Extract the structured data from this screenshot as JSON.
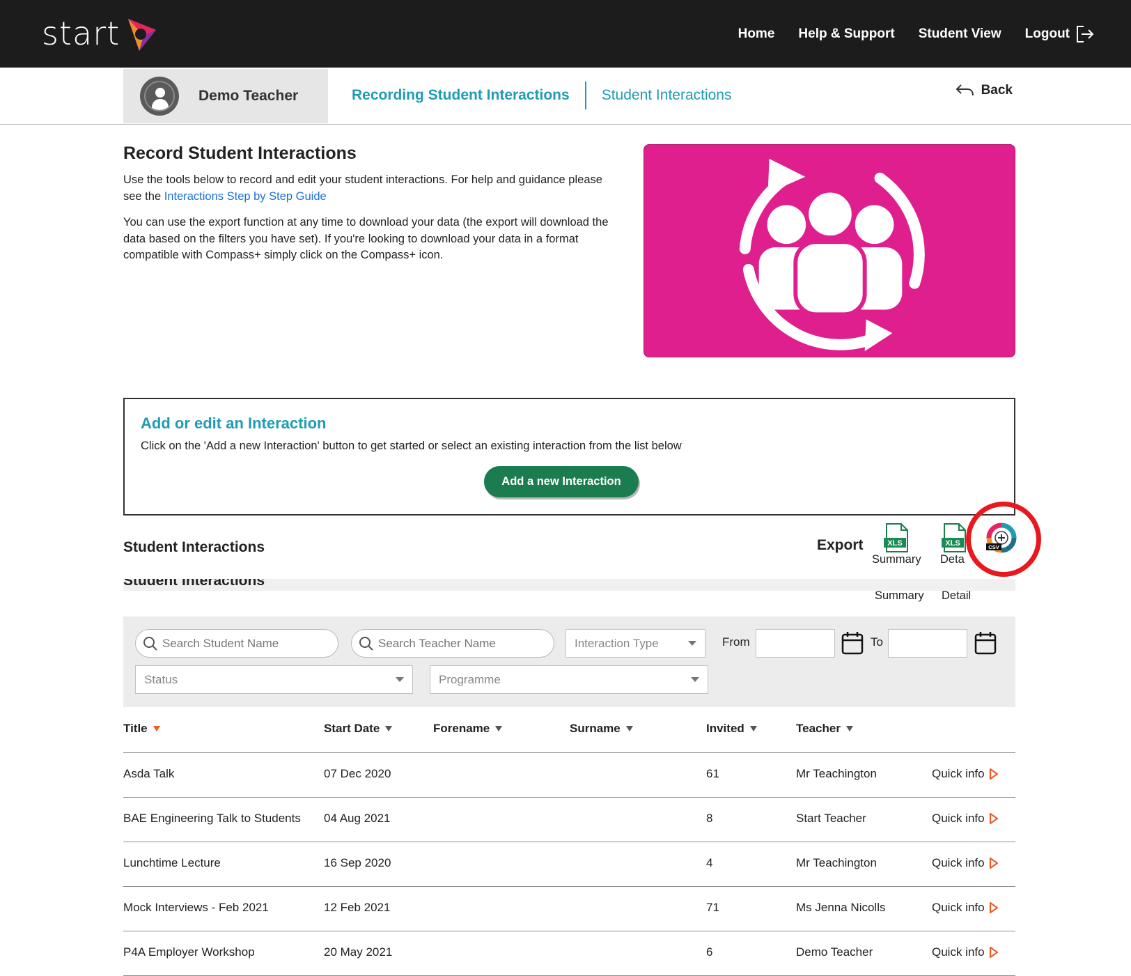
{
  "brand": {
    "name": "start"
  },
  "topnav": {
    "home": "Home",
    "help": "Help & Support",
    "student_view": "Student View",
    "logout": "Logout"
  },
  "profile": {
    "name": "Demo Teacher"
  },
  "subnav": {
    "active": "Recording Student Interactions",
    "second": "Student Interactions",
    "back": "Back"
  },
  "intro": {
    "title": "Record Student Interactions",
    "para1_before": "Use the tools below to record and edit your student interactions. For help and guidance please see the ",
    "para1_link": "Interactions Step by Step Guide",
    "para2": "You can use the export function at any time to download your data (the export will download the data based on the filters you have set). If you're looking to download your data in a format compatible with Compass+ simply click on the Compass+ icon."
  },
  "add_box": {
    "title": "Add or edit an Interaction",
    "text": "Click on the 'Add a new Interaction' button to get started or select an existing interaction from the list below",
    "button": "Add a new Interaction"
  },
  "section": {
    "title": "Student Interactions",
    "ghost_title": "Student Interactions"
  },
  "export": {
    "label": "Export",
    "summary": "Summary",
    "detail": "Detail",
    "detail_visible": "Deta",
    "xls_badge": "XLS",
    "csv_badge": "CSV"
  },
  "filters": {
    "student_placeholder": "Search Student Name",
    "teacher_placeholder": "Search Teacher Name",
    "interaction_type": "Interaction Type",
    "from": "From",
    "to": "To",
    "status": "Status",
    "programme": "Programme"
  },
  "table": {
    "columns": [
      "Title",
      "Start Date",
      "Forename",
      "Surname",
      "Invited",
      "Teacher"
    ],
    "quick_info": "Quick info",
    "rows": [
      {
        "title": "Asda Talk",
        "start_date": "07 Dec 2020",
        "forename": "",
        "surname": "",
        "invited": "61",
        "teacher": "Mr Teachington"
      },
      {
        "title": "BAE Engineering Talk to Students",
        "start_date": "04 Aug 2021",
        "forename": "",
        "surname": "",
        "invited": "8",
        "teacher": "Start Teacher"
      },
      {
        "title": "Lunchtime Lecture",
        "start_date": "16 Sep 2020",
        "forename": "",
        "surname": "",
        "invited": "4",
        "teacher": "Mr Teachington"
      },
      {
        "title": "Mock Interviews - Feb 2021",
        "start_date": "12 Feb 2021",
        "forename": "",
        "surname": "",
        "invited": "71",
        "teacher": "Ms Jenna Nicolls"
      },
      {
        "title": "P4A Employer Workshop",
        "start_date": "20 May 2021",
        "forename": "",
        "surname": "",
        "invited": "6",
        "teacher": "Demo Teacher"
      }
    ]
  },
  "colors": {
    "topbar": "#1c1c1c",
    "accent_teal": "#1f9bb5",
    "hero_pink": "#df1f8e",
    "button_green": "#1b7d4f",
    "sort_orange": "#f05a28",
    "highlight_red": "#e8181e"
  },
  "icons": [
    "start-logo-icon",
    "logout-icon",
    "avatar-icon",
    "back-arrow-icon",
    "interactions-hero-icon",
    "xls-file-icon",
    "compass-csv-icon",
    "search-icon",
    "calendar-icon",
    "chevron-down-icon",
    "play-icon"
  ]
}
